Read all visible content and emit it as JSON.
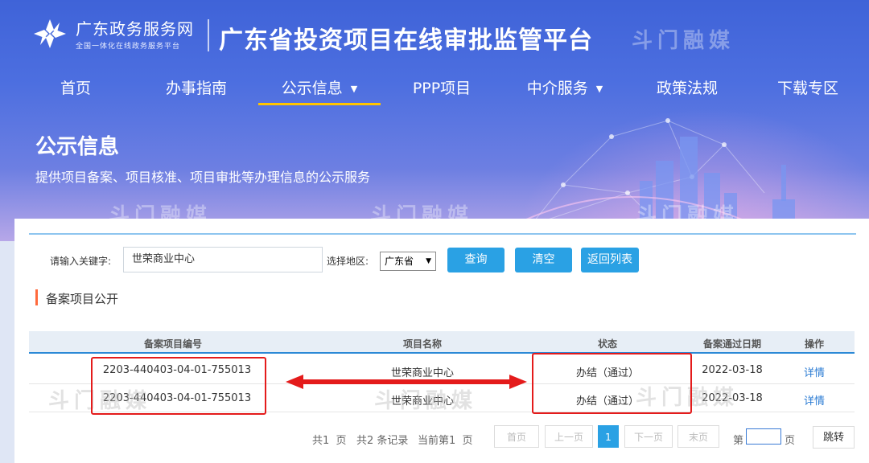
{
  "header": {
    "logo_name": "广东政务服务网",
    "logo_sub": "全国一体化在线政务服务平台",
    "platform_title": "广东省投资项目在线审批监管平台"
  },
  "nav": {
    "items": [
      {
        "label": "首页"
      },
      {
        "label": "办事指南"
      },
      {
        "label": "公示信息",
        "active": true,
        "dropdown": true
      },
      {
        "label": "PPP项目"
      },
      {
        "label": "中介服务",
        "dropdown": true
      },
      {
        "label": "政策法规"
      },
      {
        "label": "下载专区"
      }
    ]
  },
  "hero": {
    "title": "公示信息",
    "desc": "提供项目备案、项目核准、项目审批等办理信息的公示服务"
  },
  "watermark": "斗门融媒",
  "search": {
    "keyword_label": "请输入关键字:",
    "keyword_value": "世荣商业中心",
    "region_label": "选择地区:",
    "region_value": "广东省",
    "query_label": "查询",
    "clear_label": "清空",
    "back_label": "返回列表"
  },
  "section": {
    "title": "备案项目公开"
  },
  "table": {
    "columns": [
      "备案项目编号",
      "项目名称",
      "状态",
      "备案通过日期",
      "操作"
    ],
    "rows": [
      {
        "code": "2203-440403-04-01-755013",
        "name": "世荣商业中心",
        "status": "办结（通过）",
        "date": "2022-03-18",
        "action": "详情"
      },
      {
        "code": "2203-440403-04-01-755013",
        "name": "世荣商业中心",
        "status": "办结（通过）",
        "date": "2022-03-18",
        "action": "详情"
      }
    ]
  },
  "pager": {
    "total_pages_prefix": "共1",
    "total_pages_suffix": "页",
    "total_records_prefix": "共2",
    "total_records_suffix": "条记录",
    "current_prefix": "当前第1",
    "current_suffix": "页",
    "first": "首页",
    "prev": "上一页",
    "current": "1",
    "next": "下一页",
    "last": "末页",
    "goto_prefix": "第",
    "goto_suffix": "页",
    "jump": "跳转"
  },
  "colors": {
    "accent": "#2aa1e4",
    "highlight": "#e41b1b",
    "nav_active": "#ffc400",
    "link": "#2a7bd3"
  }
}
